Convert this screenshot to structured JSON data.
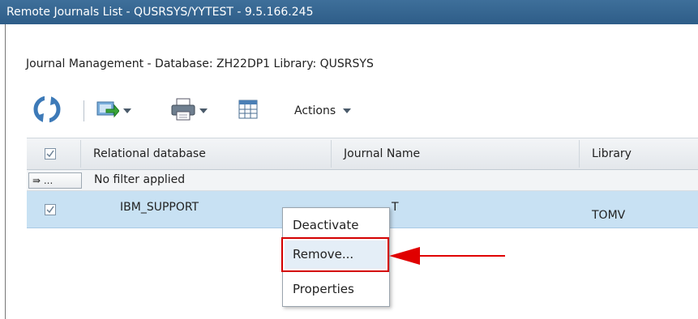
{
  "window": {
    "title": "Remote Journals List - QUSRSYS/YYTEST - 9.5.166.245"
  },
  "breadcrumb": "Journal Management - Database: ZH22DP1 Library: QUSRSYS",
  "toolbar": {
    "icons": [
      "refresh-icon",
      "export-icon",
      "print-icon",
      "table-settings-icon"
    ],
    "actions_label": "Actions"
  },
  "table": {
    "columns": [
      "Relational database",
      "Journal Name",
      "Library"
    ],
    "filter_button": "⇛ ...",
    "filter_text": "No filter applied",
    "rows": [
      {
        "relational_database": "IBM_SUPPORT",
        "journal_name_visible": "T",
        "library": "TOMV",
        "selected": true
      }
    ]
  },
  "context_menu": {
    "items": [
      "Deactivate",
      "Remove...",
      "Properties"
    ],
    "highlighted": "Remove..."
  },
  "colors": {
    "titlebar": "#2e5d88",
    "row_selected": "#c8e1f3",
    "highlight_red": "#d40000"
  }
}
